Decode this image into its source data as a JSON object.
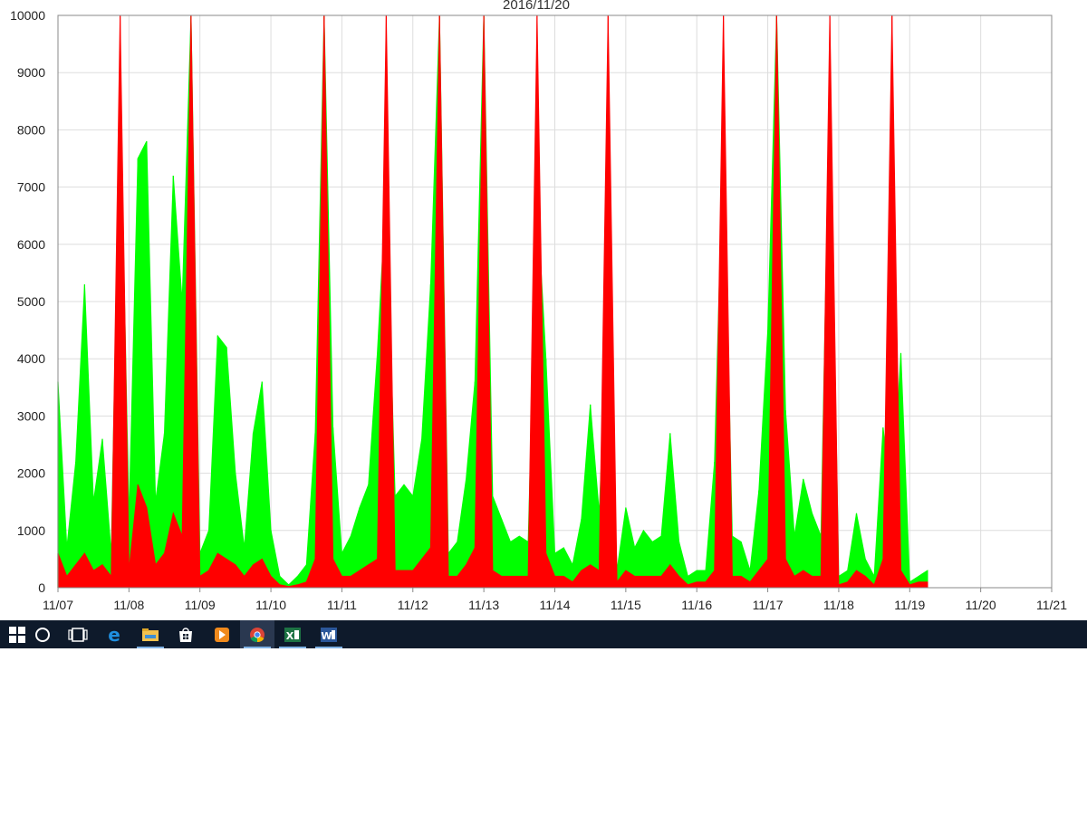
{
  "chart_data": {
    "type": "area",
    "title": "2016/11/20",
    "xlabel": "",
    "ylabel": "",
    "ylim": [
      0,
      10000
    ],
    "y_ticks": [
      0,
      1000,
      2000,
      3000,
      4000,
      5000,
      6000,
      7000,
      8000,
      9000,
      10000
    ],
    "x_ticks": [
      "11/07",
      "11/08",
      "11/09",
      "11/10",
      "11/11",
      "11/12",
      "11/13",
      "11/14",
      "11/15",
      "11/16",
      "11/17",
      "11/18",
      "11/19",
      "11/20",
      "11/21"
    ],
    "grid": true,
    "legend": "none",
    "series": [
      {
        "color": "#00ff00",
        "points": [
          [
            "11/07 00:00",
            3600
          ],
          [
            "11/07 03:00",
            700
          ],
          [
            "11/07 06:00",
            2200
          ],
          [
            "11/07 09:00",
            5300
          ],
          [
            "11/07 12:00",
            1500
          ],
          [
            "11/07 15:00",
            2600
          ],
          [
            "11/07 18:00",
            600
          ],
          [
            "11/07 21:00",
            8800
          ],
          [
            "11/08 00:00",
            1200
          ],
          [
            "11/08 03:00",
            7500
          ],
          [
            "11/08 06:00",
            7800
          ],
          [
            "11/08 09:00",
            1500
          ],
          [
            "11/08 12:00",
            2700
          ],
          [
            "11/08 15:00",
            7200
          ],
          [
            "11/08 18:00",
            5000
          ],
          [
            "11/08 21:00",
            10000
          ],
          [
            "11/09 00:00",
            600
          ],
          [
            "11/09 03:00",
            1000
          ],
          [
            "11/09 06:00",
            4400
          ],
          [
            "11/09 09:00",
            4200
          ],
          [
            "11/09 12:00",
            2000
          ],
          [
            "11/09 15:00",
            700
          ],
          [
            "11/09 18:00",
            2700
          ],
          [
            "11/09 21:00",
            3600
          ],
          [
            "11/10 00:00",
            1000
          ],
          [
            "11/10 03:00",
            200
          ],
          [
            "11/10 06:00",
            50
          ],
          [
            "11/10 09:00",
            200
          ],
          [
            "11/10 12:00",
            400
          ],
          [
            "11/10 15:00",
            2700
          ],
          [
            "11/10 18:00",
            10000
          ],
          [
            "11/10 21:00",
            2800
          ],
          [
            "11/11 00:00",
            600
          ],
          [
            "11/11 03:00",
            900
          ],
          [
            "11/11 06:00",
            1400
          ],
          [
            "11/11 09:00",
            1800
          ],
          [
            "11/11 12:00",
            4100
          ],
          [
            "11/11 15:00",
            7000
          ],
          [
            "11/11 18:00",
            1600
          ],
          [
            "11/11 21:00",
            1800
          ],
          [
            "11/12 00:00",
            1600
          ],
          [
            "11/12 03:00",
            2600
          ],
          [
            "11/12 06:00",
            5300
          ],
          [
            "11/12 09:00",
            10000
          ],
          [
            "11/12 12:00",
            600
          ],
          [
            "11/12 15:00",
            800
          ],
          [
            "11/12 18:00",
            1900
          ],
          [
            "11/12 21:00",
            3600
          ],
          [
            "11/13 00:00",
            10000
          ],
          [
            "11/13 03:00",
            1600
          ],
          [
            "11/13 06:00",
            1200
          ],
          [
            "11/13 09:00",
            800
          ],
          [
            "11/13 12:00",
            900
          ],
          [
            "11/13 15:00",
            800
          ],
          [
            "11/13 18:00",
            6800
          ],
          [
            "11/13 21:00",
            4000
          ],
          [
            "11/14 00:00",
            600
          ],
          [
            "11/14 03:00",
            700
          ],
          [
            "11/14 06:00",
            400
          ],
          [
            "11/14 09:00",
            1200
          ],
          [
            "11/14 12:00",
            3200
          ],
          [
            "11/14 15:00",
            1300
          ],
          [
            "11/14 18:00",
            5100
          ],
          [
            "11/14 21:00",
            300
          ],
          [
            "11/15 00:00",
            1400
          ],
          [
            "11/15 03:00",
            700
          ],
          [
            "11/15 06:00",
            1000
          ],
          [
            "11/15 09:00",
            800
          ],
          [
            "11/15 12:00",
            900
          ],
          [
            "11/15 15:00",
            2700
          ],
          [
            "11/15 18:00",
            800
          ],
          [
            "11/15 21:00",
            200
          ],
          [
            "11/16 00:00",
            300
          ],
          [
            "11/16 03:00",
            300
          ],
          [
            "11/16 06:00",
            2200
          ],
          [
            "11/16 09:00",
            8000
          ],
          [
            "11/16 12:00",
            900
          ],
          [
            "11/16 15:00",
            800
          ],
          [
            "11/16 18:00",
            300
          ],
          [
            "11/16 21:00",
            1700
          ],
          [
            "11/17 00:00",
            4500
          ],
          [
            "11/17 03:00",
            10000
          ],
          [
            "11/17 06:00",
            3100
          ],
          [
            "11/17 09:00",
            900
          ],
          [
            "11/17 12:00",
            1900
          ],
          [
            "11/17 15:00",
            1300
          ],
          [
            "11/17 18:00",
            900
          ],
          [
            "11/17 21:00",
            9000
          ],
          [
            "11/18 00:00",
            200
          ],
          [
            "11/18 03:00",
            300
          ],
          [
            "11/18 06:00",
            1300
          ],
          [
            "11/18 09:00",
            500
          ],
          [
            "11/18 12:00",
            200
          ],
          [
            "11/18 15:00",
            2800
          ],
          [
            "11/18 18:00",
            1300
          ],
          [
            "11/18 21:00",
            4100
          ],
          [
            "11/19 00:00",
            100
          ],
          [
            "11/19 03:00",
            200
          ],
          [
            "11/19 06:00",
            300
          ]
        ]
      },
      {
        "color": "#ff0000",
        "points": [
          [
            "11/07 00:00",
            600
          ],
          [
            "11/07 03:00",
            200
          ],
          [
            "11/07 06:00",
            400
          ],
          [
            "11/07 09:00",
            600
          ],
          [
            "11/07 12:00",
            300
          ],
          [
            "11/07 15:00",
            400
          ],
          [
            "11/07 18:00",
            200
          ],
          [
            "11/07 21:00",
            10000
          ],
          [
            "11/08 00:00",
            300
          ],
          [
            "11/08 03:00",
            1800
          ],
          [
            "11/08 06:00",
            1400
          ],
          [
            "11/08 09:00",
            400
          ],
          [
            "11/08 12:00",
            600
          ],
          [
            "11/08 15:00",
            1300
          ],
          [
            "11/08 18:00",
            900
          ],
          [
            "11/08 21:00",
            10000
          ],
          [
            "11/09 00:00",
            200
          ],
          [
            "11/09 03:00",
            300
          ],
          [
            "11/09 06:00",
            600
          ],
          [
            "11/09 09:00",
            500
          ],
          [
            "11/09 12:00",
            400
          ],
          [
            "11/09 15:00",
            200
          ],
          [
            "11/09 18:00",
            400
          ],
          [
            "11/09 21:00",
            500
          ],
          [
            "11/10 00:00",
            200
          ],
          [
            "11/10 03:00",
            50
          ],
          [
            "11/10 06:00",
            20
          ],
          [
            "11/10 09:00",
            50
          ],
          [
            "11/10 12:00",
            100
          ],
          [
            "11/10 15:00",
            500
          ],
          [
            "11/10 18:00",
            10000
          ],
          [
            "11/10 21:00",
            500
          ],
          [
            "11/11 00:00",
            200
          ],
          [
            "11/11 03:00",
            200
          ],
          [
            "11/11 06:00",
            300
          ],
          [
            "11/11 09:00",
            400
          ],
          [
            "11/11 12:00",
            500
          ],
          [
            "11/11 15:00",
            10000
          ],
          [
            "11/11 18:00",
            300
          ],
          [
            "11/11 21:00",
            300
          ],
          [
            "11/12 00:00",
            300
          ],
          [
            "11/12 03:00",
            500
          ],
          [
            "11/12 06:00",
            700
          ],
          [
            "11/12 09:00",
            10000
          ],
          [
            "11/12 12:00",
            200
          ],
          [
            "11/12 15:00",
            200
          ],
          [
            "11/12 18:00",
            400
          ],
          [
            "11/12 21:00",
            700
          ],
          [
            "11/13 00:00",
            10000
          ],
          [
            "11/13 03:00",
            300
          ],
          [
            "11/13 06:00",
            200
          ],
          [
            "11/13 09:00",
            200
          ],
          [
            "11/13 12:00",
            200
          ],
          [
            "11/13 15:00",
            200
          ],
          [
            "11/13 18:00",
            10000
          ],
          [
            "11/13 21:00",
            600
          ],
          [
            "11/14 00:00",
            200
          ],
          [
            "11/14 03:00",
            200
          ],
          [
            "11/14 06:00",
            100
          ],
          [
            "11/14 09:00",
            300
          ],
          [
            "11/14 12:00",
            400
          ],
          [
            "11/14 15:00",
            300
          ],
          [
            "11/14 18:00",
            10000
          ],
          [
            "11/14 21:00",
            100
          ],
          [
            "11/15 00:00",
            300
          ],
          [
            "11/15 03:00",
            200
          ],
          [
            "11/15 06:00",
            200
          ],
          [
            "11/15 09:00",
            200
          ],
          [
            "11/15 12:00",
            200
          ],
          [
            "11/15 15:00",
            400
          ],
          [
            "11/15 18:00",
            200
          ],
          [
            "11/15 21:00",
            50
          ],
          [
            "11/16 00:00",
            100
          ],
          [
            "11/16 03:00",
            100
          ],
          [
            "11/16 06:00",
            300
          ],
          [
            "11/16 09:00",
            10000
          ],
          [
            "11/16 12:00",
            200
          ],
          [
            "11/16 15:00",
            200
          ],
          [
            "11/16 18:00",
            100
          ],
          [
            "11/16 21:00",
            300
          ],
          [
            "11/17 00:00",
            500
          ],
          [
            "11/17 03:00",
            10000
          ],
          [
            "11/17 06:00",
            500
          ],
          [
            "11/17 09:00",
            200
          ],
          [
            "11/17 12:00",
            300
          ],
          [
            "11/17 15:00",
            200
          ],
          [
            "11/17 18:00",
            200
          ],
          [
            "11/17 21:00",
            10000
          ],
          [
            "11/18 00:00",
            50
          ],
          [
            "11/18 03:00",
            100
          ],
          [
            "11/18 06:00",
            300
          ],
          [
            "11/18 09:00",
            200
          ],
          [
            "11/18 12:00",
            50
          ],
          [
            "11/18 15:00",
            500
          ],
          [
            "11/18 18:00",
            10000
          ],
          [
            "11/18 21:00",
            300
          ],
          [
            "11/19 00:00",
            50
          ],
          [
            "11/19 03:00",
            100
          ],
          [
            "11/19 06:00",
            100
          ]
        ]
      }
    ]
  },
  "taskbar": {
    "icons": [
      {
        "icon": "windows-start-icon",
        "color": "#ffffff"
      },
      {
        "icon": "cortana-icon",
        "color": "#ffffff"
      },
      {
        "icon": "task-view-icon",
        "color": "#ffffff"
      },
      {
        "icon": "edge-icon",
        "color": "#1f8fe0"
      },
      {
        "icon": "file-explorer-icon",
        "color": "#f2c14e"
      },
      {
        "icon": "store-icon",
        "color": "#ffffff"
      },
      {
        "icon": "media-player-icon",
        "color": "#f08a1c"
      },
      {
        "icon": "chrome-icon",
        "color": "#db4437"
      },
      {
        "icon": "excel-icon",
        "color": "#1d7344",
        "label": "X"
      },
      {
        "icon": "word-icon",
        "color": "#2b579a",
        "label": "W"
      }
    ]
  }
}
